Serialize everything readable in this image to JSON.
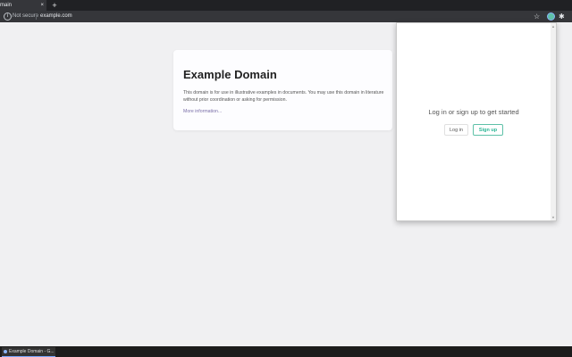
{
  "browser": {
    "tab_title": "main",
    "tab_close": "×",
    "new_tab": "+",
    "address": {
      "security_icon": "info-icon",
      "security_label": "Not secure",
      "url": "example.com"
    },
    "toolbar_icons": [
      "star-icon",
      "extension-icon",
      "puzzle-icon"
    ]
  },
  "page": {
    "title": "Example Domain",
    "paragraph": "This domain is for use in illustrative examples in documents. You may use this domain in literature without prior coordination or asking for permission.",
    "link": "More information..."
  },
  "popup": {
    "message": "Log in or sign up to get started",
    "login_label": "Log in",
    "signup_label": "Sign up"
  },
  "taskbar": {
    "item_label": "Example Domain - G..."
  },
  "colors": {
    "accent": "#5fc1a8",
    "chrome_dark": "#35363a",
    "page_bg": "#f0f0f2"
  }
}
